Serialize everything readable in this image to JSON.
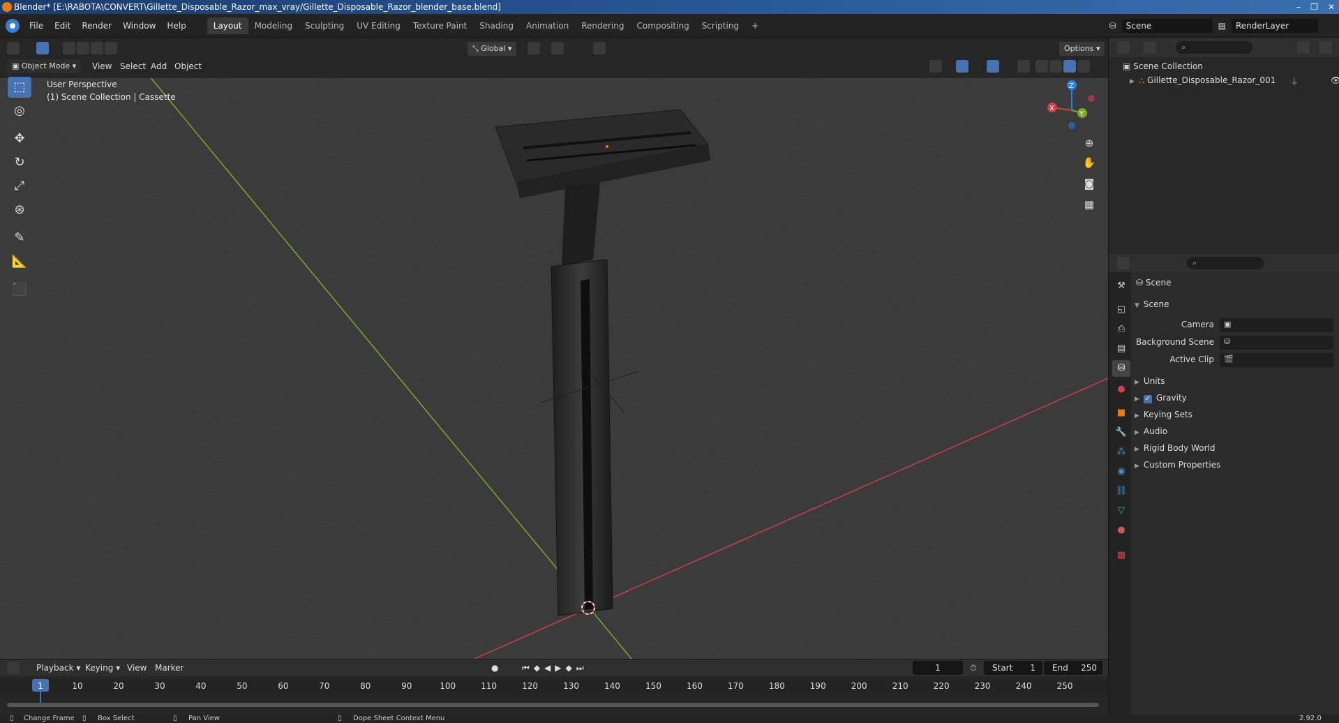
{
  "window": {
    "title": "Blender* [E:\\RABOTA\\CONVERT\\Gillette_Disposable_Razor_max_vray/Gillette_Disposable_Razor_blender_base.blend]",
    "buttons": [
      "–",
      "❐",
      "✕"
    ]
  },
  "menubar": {
    "menus": [
      "File",
      "Edit",
      "Render",
      "Window",
      "Help"
    ],
    "workspaces": [
      "Layout",
      "Modeling",
      "Sculpting",
      "UV Editing",
      "Texture Paint",
      "Shading",
      "Animation",
      "Rendering",
      "Compositing",
      "Scripting"
    ],
    "add_tab": "+",
    "scene_name": "Scene",
    "view_layer": "RenderLayer"
  },
  "viewport_header": {
    "mode": "Object Mode",
    "menus": [
      "View",
      "Select",
      "Add",
      "Object"
    ],
    "orientation": "Global",
    "options": "Options"
  },
  "viewport": {
    "perspective": "User Perspective",
    "collection_info": "(1) Scene Collection | Cassette",
    "axis_labels": {
      "x": "X",
      "y": "Y",
      "z": "Z"
    }
  },
  "outliner": {
    "root": "Scene Collection",
    "items": [
      "Gillette_Disposable_Razor_001"
    ]
  },
  "properties": {
    "context": "Scene",
    "section_title": "Scene",
    "fields": [
      {
        "label": "Camera",
        "value": ""
      },
      {
        "label": "Background Scene",
        "value": ""
      },
      {
        "label": "Active Clip",
        "value": ""
      }
    ],
    "panels": [
      "Units",
      "Gravity",
      "Keying Sets",
      "Audio",
      "Rigid Body World",
      "Custom Properties"
    ],
    "gravity_checked": true
  },
  "timeline": {
    "menus": [
      "Playback",
      "Keying",
      "View",
      "Marker"
    ],
    "current_frame": "1",
    "start_label": "Start",
    "start": "1",
    "end_label": "End",
    "end": "250",
    "ticks": [
      "1",
      "10",
      "20",
      "30",
      "40",
      "50",
      "60",
      "70",
      "80",
      "90",
      "100",
      "110",
      "120",
      "130",
      "140",
      "150",
      "160",
      "170",
      "180",
      "190",
      "200",
      "210",
      "220",
      "230",
      "240",
      "250"
    ]
  },
  "statusbar": {
    "items": [
      "Change Frame",
      "Box Select",
      "Pan View",
      "Dope Sheet Context Menu"
    ],
    "version": "2.92.0"
  },
  "colors": {
    "accent": "#4772b3",
    "x_axis": "#c8414b",
    "y_axis": "#7ea82b",
    "z_axis": "#2f7fe0",
    "origin": "#e87d0d"
  }
}
